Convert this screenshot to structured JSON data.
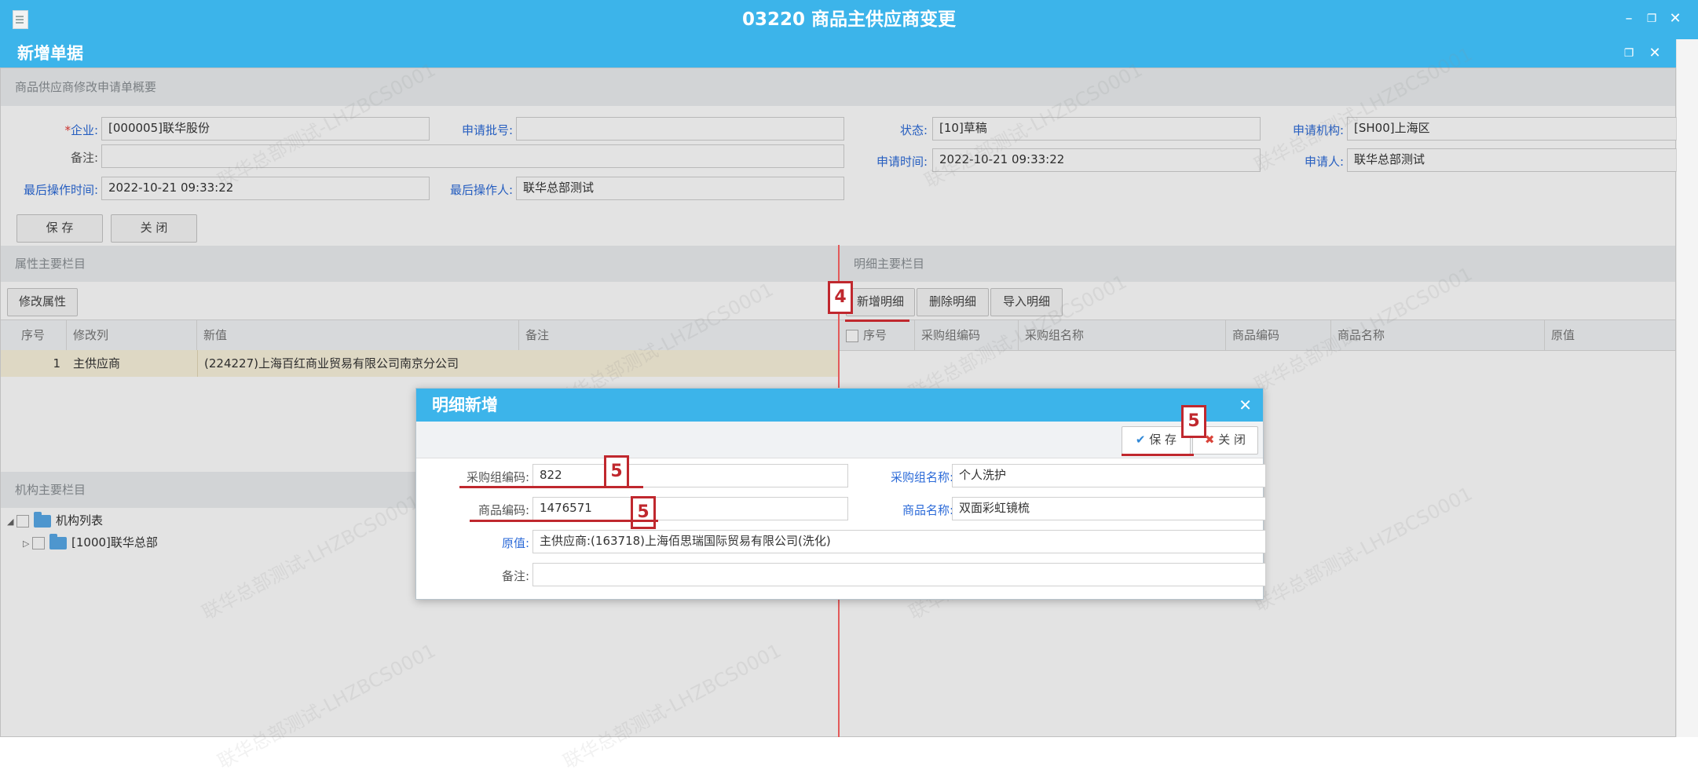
{
  "window": {
    "title": "03220 商品主供应商变更"
  },
  "subwindow": {
    "title": "新增单据"
  },
  "summary_section": {
    "title": "商品供应商修改申请单概要"
  },
  "form": {
    "company_label": "企业:",
    "company_value": "[000005]联华股份",
    "batch_label": "申请批号:",
    "batch_value": "",
    "status_label": "状态:",
    "status_value": "[10]草稿",
    "org_label": "申请机构:",
    "org_value": "[SH00]上海区",
    "remark_label": "备注:",
    "remark_value": "",
    "apply_time_label": "申请时间:",
    "apply_time_value": "2022-10-21 09:33:22",
    "applicant_label": "申请人:",
    "applicant_value": "联华总部测试",
    "last_op_time_label": "最后操作时间:",
    "last_op_time_value": "2022-10-21 09:33:22",
    "last_operator_label": "最后操作人:",
    "last_operator_value": "联华总部测试"
  },
  "top_buttons": {
    "save": "保 存",
    "close": "关 闭"
  },
  "attr_section": {
    "title": "属性主要栏目",
    "modify_button": "修改属性",
    "columns": [
      "序号",
      "修改列",
      "新值",
      "备注"
    ],
    "rows": [
      {
        "no": "1",
        "column": "主供应商",
        "new_value": "(224227)上海百红商业贸易有限公司南京分公司",
        "remark": ""
      }
    ]
  },
  "detail_section": {
    "title": "明细主要栏目",
    "buttons": {
      "add": "新增明细",
      "delete": "删除明细",
      "import": "导入明细"
    },
    "columns": [
      "序号",
      "采购组编码",
      "采购组名称",
      "商品编码",
      "商品名称",
      "原值"
    ]
  },
  "org_section": {
    "title": "机构主要栏目",
    "tree": [
      {
        "label": "机构列表"
      },
      {
        "label": "[1000]联华总部"
      }
    ]
  },
  "dialog": {
    "title": "明细新增",
    "save_button": "保 存",
    "close_button": "关 闭",
    "purchase_group_code_label": "采购组编码:",
    "purchase_group_code_value": "822",
    "purchase_group_name_label": "采购组名称:",
    "purchase_group_name_value": "个人洗护",
    "product_code_label": "商品编码:",
    "product_code_value": "1476571",
    "product_name_label": "商品名称:",
    "product_name_value": "双面彩虹镜梳",
    "original_label": "原值:",
    "original_value": "主供应商:(163718)上海佰思瑞国际贸易有限公司(洗化)",
    "remark_label": "备注:",
    "remark_value": ""
  },
  "annotations": {
    "step4": "4",
    "step5": "5"
  },
  "watermark": "联华总部测试-LHZBCS0001",
  "colors": {
    "titlebar": "#3cb4ea",
    "link_label": "#2b6ad8",
    "annotation": "#c0282e",
    "selected_row": "#faf3dd"
  },
  "icons": {
    "doc": "document-icon",
    "minimize": "minimize-icon",
    "restore": "restore-icon",
    "close": "close-icon",
    "check": "check-icon",
    "cross": "cross-icon",
    "folder": "folder-icon"
  }
}
